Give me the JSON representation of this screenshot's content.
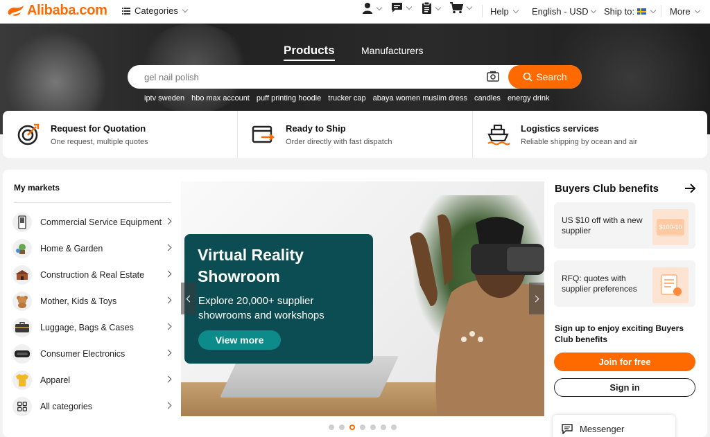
{
  "header": {
    "logo_text": "Alibaba.com",
    "categories_label": "Categories",
    "help_label": "Help",
    "language_label": "English - USD",
    "ship_to_label": "Ship to:",
    "more_label": "More",
    "icons": [
      "user-icon",
      "message-icon",
      "orders-icon",
      "cart-icon"
    ]
  },
  "hero": {
    "tabs": [
      {
        "label": "Products",
        "active": true
      },
      {
        "label": "Manufacturers",
        "active": false
      }
    ],
    "search": {
      "placeholder": "gel nail polish",
      "button_label": "Search"
    },
    "suggestions": [
      "iptv sweden",
      "hbo max account",
      "puff printing hoodie",
      "trucker cap",
      "abaya women muslim dress",
      "candles",
      "energy drink"
    ]
  },
  "services": [
    {
      "title": "Request for Quotation",
      "subtitle": "One request, multiple quotes",
      "icon": "target-icon"
    },
    {
      "title": "Ready to Ship",
      "subtitle": "Order directly with fast dispatch",
      "icon": "box-arrow-icon"
    },
    {
      "title": "Logistics services",
      "subtitle": "Reliable shipping by ocean and air",
      "icon": "ship-icon"
    }
  ],
  "markets": {
    "heading": "My markets",
    "items": [
      {
        "label": "Commercial Service Equipment",
        "icon": "kiosk-icon"
      },
      {
        "label": "Home & Garden",
        "icon": "garden-icon"
      },
      {
        "label": "Construction & Real Estate",
        "icon": "house-icon"
      },
      {
        "label": "Mother, Kids & Toys",
        "icon": "teddy-bear-icon"
      },
      {
        "label": "Luggage, Bags & Cases",
        "icon": "bag-icon"
      },
      {
        "label": "Consumer Electronics",
        "icon": "vr-headset-icon"
      },
      {
        "label": "Apparel",
        "icon": "shirt-icon"
      },
      {
        "label": "All categories",
        "icon": "grid-icon"
      }
    ]
  },
  "banner": {
    "title": "Virtual Reality Showroom",
    "subtitle": "Explore 20,000+ supplier showrooms and workshops",
    "cta_label": "View more",
    "slide_count": 7,
    "active_slide": 3
  },
  "buyers_club": {
    "heading": "Buyers Club benefits",
    "cards": [
      {
        "text": "US $10 off with a new supplier",
        "icon": "coupon-icon",
        "img_text": "$100-10"
      },
      {
        "text": "RFQ: quotes with supplier preferences",
        "icon": "rfq-document-icon"
      }
    ],
    "signup_text": "Sign up to enjoy exciting Buyers Club benefits",
    "join_label": "Join for free",
    "signin_label": "Sign in"
  },
  "messenger": {
    "label": "Messenger"
  },
  "colors": {
    "accent": "#ff6a00",
    "promo_bg": "#0b4d52",
    "promo_button": "#0d8a8a"
  }
}
